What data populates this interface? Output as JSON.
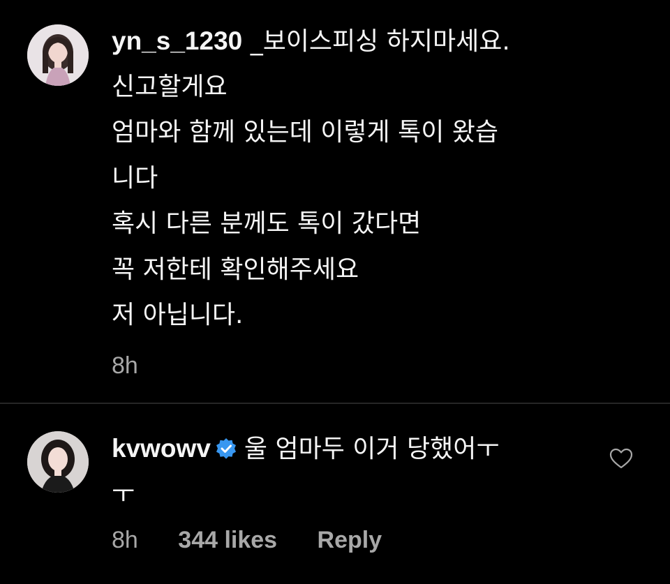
{
  "comments": [
    {
      "username": "yn_s_1230",
      "lines": [
        "_보이스피싱 하지마세요.",
        "신고할게요",
        "엄마와 함께 있는데 이렇게 톡이 왔습",
        "니다",
        "혹시 다른 분께도 톡이 갔다면",
        "꼭 저한테 확인해주세요",
        "저 아닙니다."
      ],
      "time": "8h"
    },
    {
      "username": "kvwowv",
      "verified": true,
      "lines": [
        "울 엄마두 이거 당했어ㅜ",
        "ㅜ"
      ],
      "time": "8h",
      "likes": "344 likes",
      "reply_label": "Reply",
      "like_icon": "heart-outline-icon"
    }
  ],
  "colors": {
    "background": "#000000",
    "text": "#f5f5f5",
    "meta": "#a8a8a8",
    "verified": "#3897f0",
    "divider": "#262626"
  }
}
